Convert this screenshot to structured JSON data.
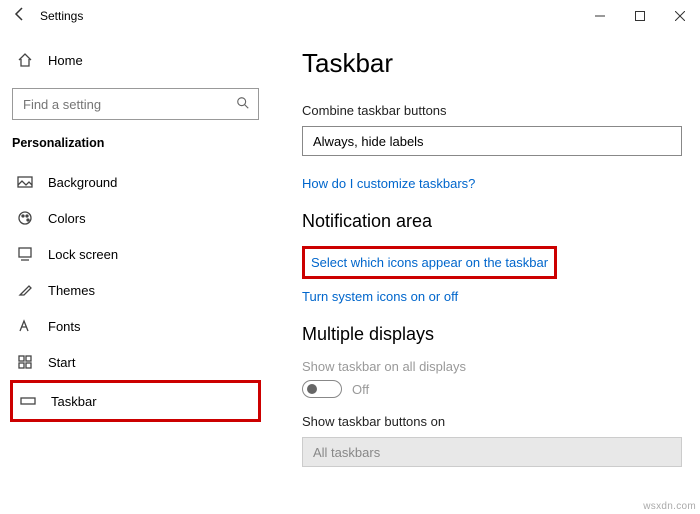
{
  "window": {
    "title": "Settings"
  },
  "sidebar": {
    "home": "Home",
    "search_placeholder": "Find a setting",
    "section": "Personalization",
    "items": [
      {
        "label": "Background"
      },
      {
        "label": "Colors"
      },
      {
        "label": "Lock screen"
      },
      {
        "label": "Themes"
      },
      {
        "label": "Fonts"
      },
      {
        "label": "Start"
      },
      {
        "label": "Taskbar"
      }
    ]
  },
  "main": {
    "heading": "Taskbar",
    "combine_label": "Combine taskbar buttons",
    "combine_value": "Always, hide labels",
    "customize_link": "How do I customize taskbars?",
    "notification_heading": "Notification area",
    "select_icons_link": "Select which icons appear on the taskbar",
    "system_icons_link": "Turn system icons on or off",
    "multiple_heading": "Multiple displays",
    "show_all_label": "Show taskbar on all displays",
    "toggle_state": "Off",
    "show_buttons_label": "Show taskbar buttons on",
    "show_buttons_value": "All taskbars"
  },
  "watermark": "wsxdn.com"
}
